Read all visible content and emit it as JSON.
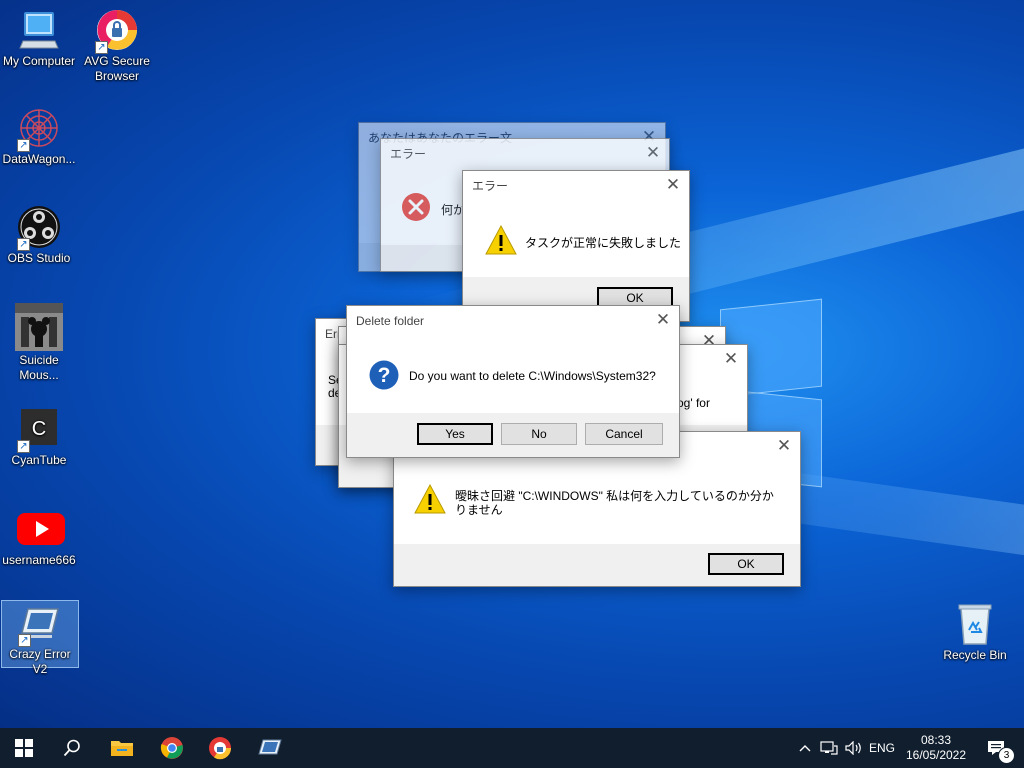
{
  "desktop": {
    "icons": [
      {
        "label": "My Computer"
      },
      {
        "label": "AVG Secure Browser"
      },
      {
        "label": "DataWagon..."
      },
      {
        "label": "OBS Studio"
      },
      {
        "label": "Suicide Mous..."
      },
      {
        "label": "CyanTube"
      },
      {
        "label": "username666"
      },
      {
        "label": "Crazy Error V2"
      },
      {
        "label": "Recycle Bin"
      }
    ]
  },
  "dialogs": {
    "back_title": "あなたはあなたのエラー文",
    "error_jp": {
      "title": "エラー",
      "message": "何か問題が発生しました"
    },
    "task_fail": {
      "title": "エラー",
      "message": "タスクが正常に失敗しました",
      "ok": "OK"
    },
    "error_left": {
      "title": "Erro",
      "message": "Se de"
    },
    "right_partial": {
      "message": "og' for"
    },
    "delete_folder": {
      "title": "Delete folder",
      "message": "Do you want to delete C:\\Windows\\System32?",
      "yes": "Yes",
      "no": "No",
      "cancel": "Cancel"
    },
    "ambiguity": {
      "message": "曖昧さ回避 \"C:\\WINDOWS\" 私は何を入力しているのか分かりません",
      "ok": "OK"
    }
  },
  "taskbar": {
    "language": "ENG",
    "time": "08:33",
    "date": "16/05/2022",
    "notification_count": "3"
  },
  "colors": {
    "taskbar": "#101e2e",
    "accent": "#0078d7",
    "error_red": "#e8453c",
    "warning_yellow": "#f7d000",
    "question_blue": "#1e5fb8"
  }
}
